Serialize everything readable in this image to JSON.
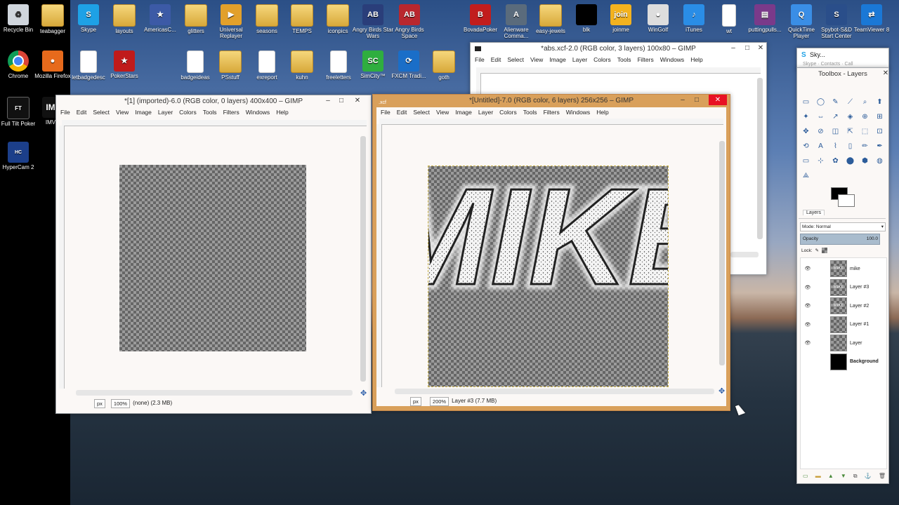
{
  "desktop": {
    "left_icons": [
      {
        "label": "Recycle Bin",
        "icon": "recycle-bin-icon"
      },
      {
        "label": "Chrome",
        "icon": "chrome-icon"
      },
      {
        "label": "Full Tilt Poker",
        "icon": "full-tilt-icon"
      },
      {
        "label": "HyperCam 2",
        "icon": "hypercam-icon"
      }
    ],
    "imv_label": "IMV",
    "top_icons": [
      {
        "label": "teabagger",
        "kind": "folder"
      },
      {
        "label": "Skype",
        "kind": "app",
        "color": "#1ea1e6",
        "glyph": "S"
      },
      {
        "label": "layouts",
        "kind": "folder"
      },
      {
        "label": "AmericasC...",
        "kind": "app",
        "color": "#3c5aa6",
        "glyph": "★"
      },
      {
        "label": "glitters",
        "kind": "folder"
      },
      {
        "label": "Universal Replayer",
        "kind": "app",
        "color": "#e2a02b",
        "glyph": "▶"
      },
      {
        "label": "seasons",
        "kind": "folder"
      },
      {
        "label": "TEMPS",
        "kind": "folder"
      },
      {
        "label": "iconpics",
        "kind": "folder"
      },
      {
        "label": "Angry Birds Star Wars",
        "kind": "app",
        "color": "#2a3e7a",
        "glyph": "AB"
      },
      {
        "label": "Angry Birds Space",
        "kind": "app",
        "color": "#b9272e",
        "glyph": "AB"
      },
      {
        "label": "BovadaPoker",
        "kind": "app",
        "color": "#c11d1d",
        "glyph": "B"
      },
      {
        "label": "Alienware Comma...",
        "kind": "app",
        "color": "#5a6b7c",
        "glyph": "A"
      },
      {
        "label": "easy-jewels",
        "kind": "folder"
      },
      {
        "label": "blk",
        "kind": "app",
        "color": "#000000",
        "glyph": ""
      },
      {
        "label": "joinme",
        "kind": "app",
        "color": "#f3b21f",
        "glyph": "join"
      },
      {
        "label": "WinGolf",
        "kind": "app",
        "color": "#dddddd",
        "glyph": "●"
      },
      {
        "label": "iTunes",
        "kind": "app",
        "color": "#2a8de6",
        "glyph": "♪"
      },
      {
        "label": "wt",
        "kind": "doc"
      },
      {
        "label": "puttingpulls...",
        "kind": "app",
        "color": "#7a3a8a",
        "glyph": "▤"
      },
      {
        "label": "QuickTime Player",
        "kind": "app",
        "color": "#3a8ee6",
        "glyph": "Q"
      },
      {
        "label": "Spybot-S&D Start Center",
        "kind": "app",
        "color": "#2a4e8a",
        "glyph": "S"
      },
      {
        "label": "TeamViewer 8",
        "kind": "app",
        "color": "#1a78d6",
        "glyph": "⇄"
      }
    ],
    "second_row": [
      {
        "label": "Mozilla Firefox",
        "kind": "app",
        "color": "#e76a1c",
        "glyph": "●"
      },
      {
        "label": "letbadgedesc",
        "kind": "doc"
      },
      {
        "label": "PokerStars",
        "kind": "app",
        "color": "#c01b1b",
        "glyph": "★"
      },
      {
        "label": "badgeideas",
        "kind": "doc"
      },
      {
        "label": "PSstuff",
        "kind": "folder"
      },
      {
        "label": "exreport",
        "kind": "doc"
      },
      {
        "label": "kuhn",
        "kind": "folder"
      },
      {
        "label": "freeletters",
        "kind": "doc"
      },
      {
        "label": "SimCity™",
        "kind": "app",
        "color": "#2fae3f",
        "glyph": "SC"
      },
      {
        "label": "FXCM Tradi...",
        "kind": "app",
        "color": "#1a6ec8",
        "glyph": "⟳"
      },
      {
        "label": "goth",
        "kind": "folder"
      }
    ]
  },
  "windows": {
    "imported": {
      "title": "*[1] (imported)-6.0 (RGB color, 0 layers) 400x400 – GIMP",
      "zoom": "100%",
      "unit": "px",
      "status": "(none) (2.3 MB)"
    },
    "untitled": {
      "title": "*[Untitled]-7.0 (RGB color, 6 layers) 256x256 – GIMP",
      "zoom": "200%",
      "unit": "px",
      "status": "Layer #3 (7.7 MB)",
      "canvas_text": "MIKE"
    },
    "abs": {
      "title": "*abs.xcf-2.0 (RGB color, 3 layers) 100x80 – GIMP"
    },
    "menu": [
      "File",
      "Edit",
      "Select",
      "View",
      "Image",
      "Layer",
      "Colors",
      "Tools",
      "Filters",
      "Windows",
      "Help"
    ]
  },
  "skype_partial": {
    "title": "Sky...",
    "subtitle": "Skype · Contacts · Call"
  },
  "toolbox": {
    "title": "Toolbox - Layers",
    "tab": "Layers",
    "mode_label": "Mode: Normal",
    "opacity_label": "Opacity",
    "opacity_value": "100.0",
    "lock_label": "Lock:",
    "layers": [
      {
        "name": "mike",
        "thumb": "mike"
      },
      {
        "name": "Layer #3",
        "thumb": "mike"
      },
      {
        "name": "Layer #2",
        "thumb": "mike"
      },
      {
        "name": "Layer #1",
        "thumb": "checker"
      },
      {
        "name": "Layer",
        "thumb": "checker"
      },
      {
        "name": "Background",
        "thumb": "black"
      }
    ]
  },
  "colors": {
    "gimp_frame": "#d9a05b",
    "accent": "#e81123"
  }
}
